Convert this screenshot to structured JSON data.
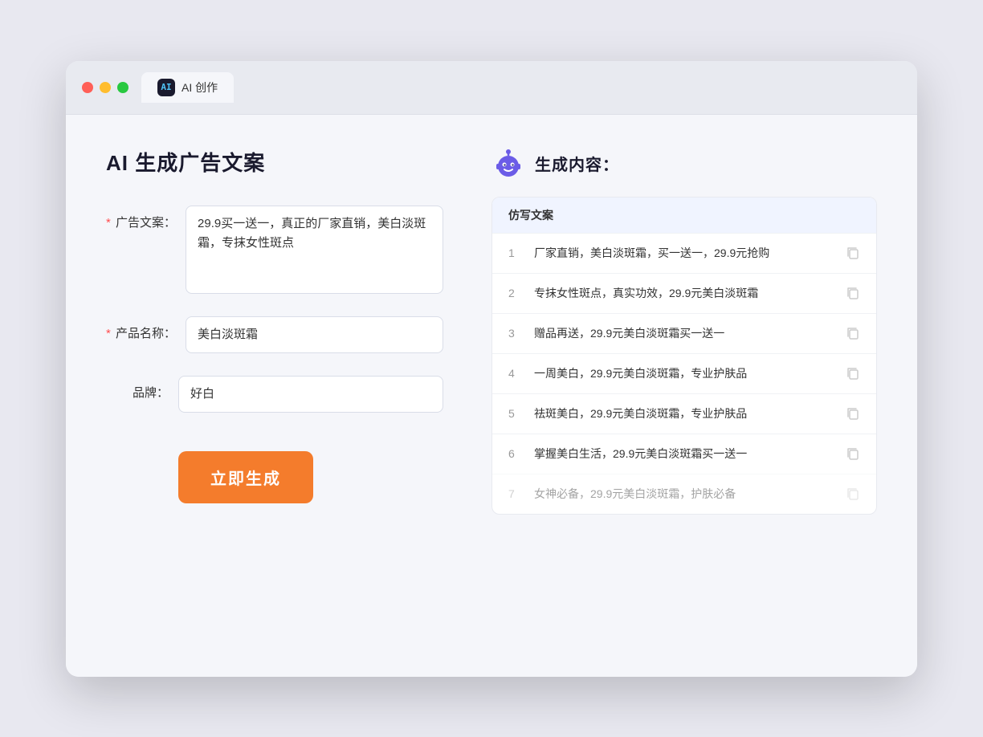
{
  "tab": {
    "icon_label": "AI",
    "label": "AI 创作"
  },
  "left_panel": {
    "title": "AI 生成广告文案",
    "fields": [
      {
        "id": "ad_copy",
        "label": "广告文案：",
        "required": true,
        "value": "29.9买一送一，真正的厂家直销，美白淡斑霜，专抹女性斑点",
        "type": "textarea",
        "placeholder": ""
      },
      {
        "id": "product_name",
        "label": "产品名称：",
        "required": true,
        "value": "美白淡斑霜",
        "type": "input",
        "placeholder": ""
      },
      {
        "id": "brand",
        "label": "品牌：",
        "required": false,
        "value": "好白",
        "type": "input",
        "placeholder": ""
      }
    ],
    "button_label": "立即生成"
  },
  "right_panel": {
    "title": "生成内容：",
    "table_header": "仿写文案",
    "results": [
      {
        "num": "1",
        "text": "厂家直销，美白淡斑霜，买一送一，29.9元抢购"
      },
      {
        "num": "2",
        "text": "专抹女性斑点，真实功效，29.9元美白淡斑霜"
      },
      {
        "num": "3",
        "text": "赠品再送，29.9元美白淡斑霜买一送一"
      },
      {
        "num": "4",
        "text": "一周美白，29.9元美白淡斑霜，专业护肤品"
      },
      {
        "num": "5",
        "text": "祛斑美白，29.9元美白淡斑霜，专业护肤品"
      },
      {
        "num": "6",
        "text": "掌握美白生活，29.9元美白淡斑霜买一送一"
      },
      {
        "num": "7",
        "text": "女神必备，29.9元美白淡斑霜，护肤必备"
      }
    ]
  }
}
